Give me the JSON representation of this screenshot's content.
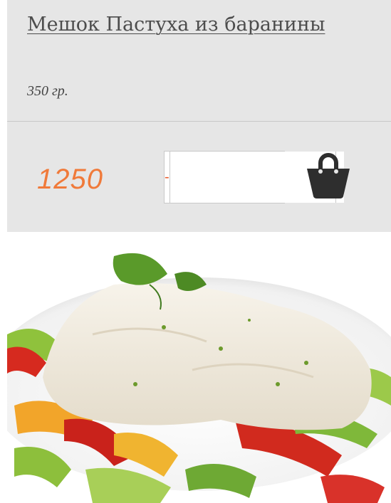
{
  "product": {
    "title": "Мешок Пастуха из баранины",
    "weight": "350 гр.",
    "price": "1250",
    "quantity": {
      "minus_label": "-",
      "plus_label": "+",
      "value": ""
    },
    "cart_icon": "shopping-bag-icon",
    "image_alt": "fish fillet with vegetables"
  },
  "colors": {
    "panel_bg": "#e6e6e6",
    "price": "#f07a3a",
    "stepper_accent": "#e85b2d",
    "cart_icon": "#2e2e2e"
  }
}
